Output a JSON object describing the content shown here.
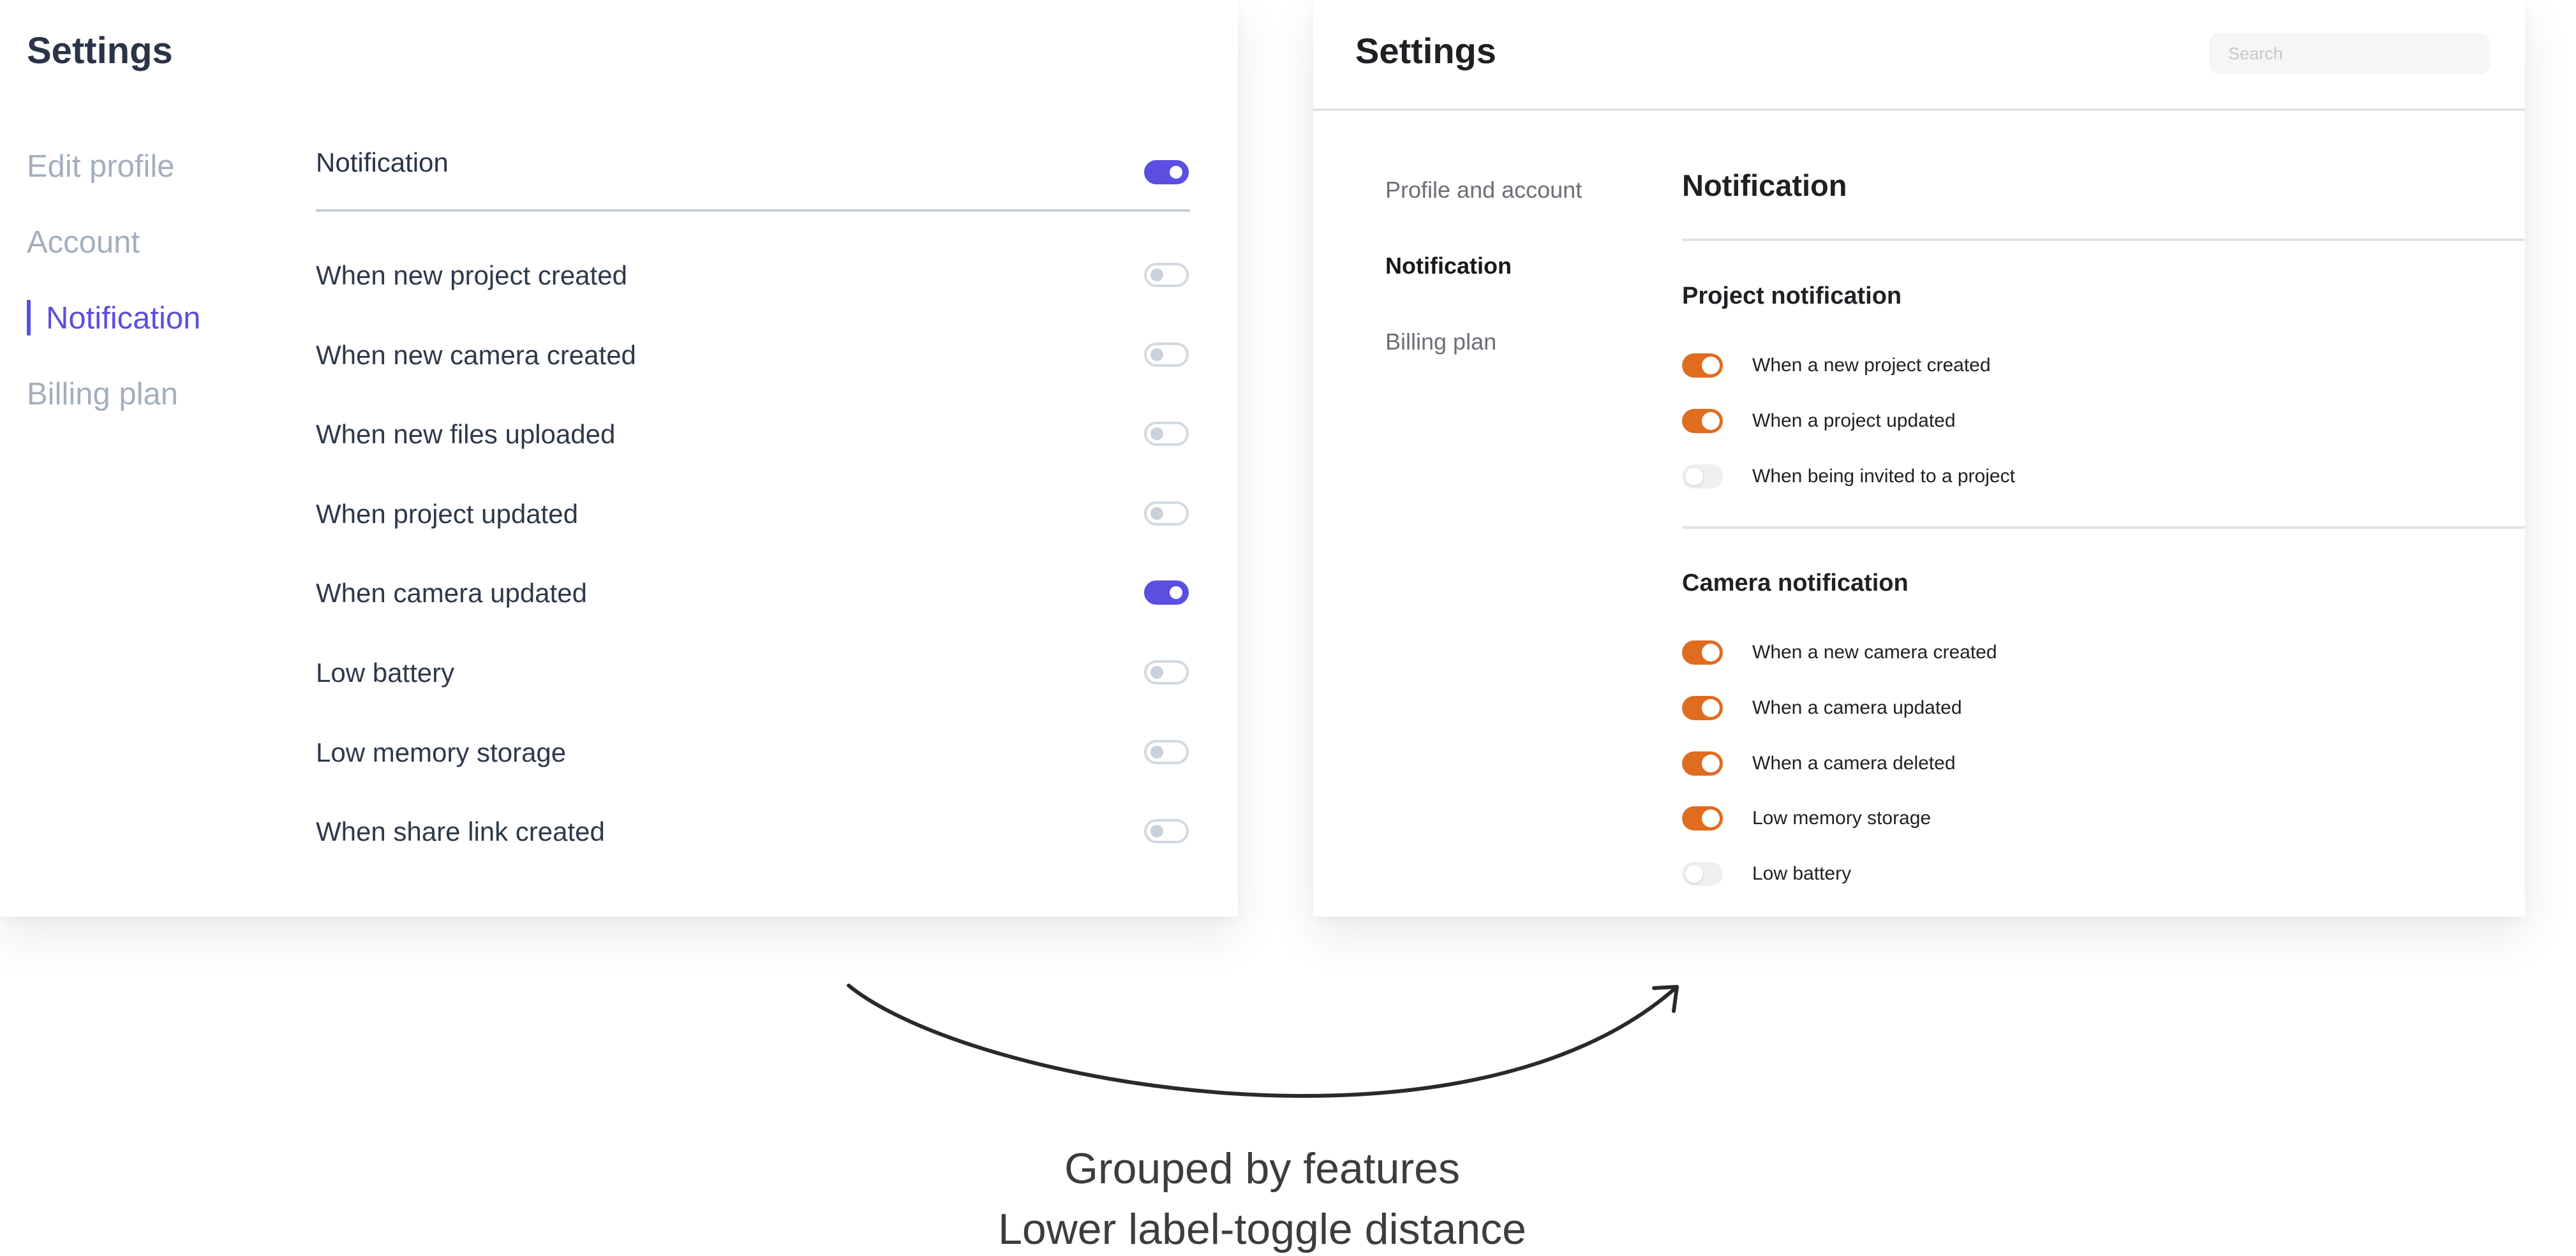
{
  "before": {
    "title": "Settings",
    "nav": [
      {
        "label": "Edit profile",
        "active": false
      },
      {
        "label": "Account",
        "active": false
      },
      {
        "label": "Notification",
        "active": true
      },
      {
        "label": "Billing plan",
        "active": false
      }
    ],
    "master": {
      "label": "Notification",
      "on": true
    },
    "rows": [
      {
        "label": "When new project created",
        "on": false
      },
      {
        "label": "When new camera created",
        "on": false
      },
      {
        "label": "When new files uploaded",
        "on": false
      },
      {
        "label": "When project updated",
        "on": false
      },
      {
        "label": "When camera updated",
        "on": true
      },
      {
        "label": "Low battery",
        "on": false
      },
      {
        "label": "Low memory storage",
        "on": false
      },
      {
        "label": "When share link created",
        "on": false
      }
    ],
    "accent_color": "#5a4fe0"
  },
  "after": {
    "title": "Settings",
    "search": {
      "placeholder": "Search",
      "value": ""
    },
    "nav": [
      {
        "label": "Profile and account",
        "active": false
      },
      {
        "label": "Notification",
        "active": true
      },
      {
        "label": "Billing plan",
        "active": false
      }
    ],
    "heading": "Notification",
    "groups": [
      {
        "title": "Project notification",
        "rows": [
          {
            "label": "When a new project created",
            "on": true
          },
          {
            "label": "When a project updated",
            "on": true
          },
          {
            "label": "When being invited to a project",
            "on": false
          }
        ]
      },
      {
        "title": "Camera notification",
        "rows": [
          {
            "label": "When a new camera created",
            "on": true
          },
          {
            "label": "When a camera updated",
            "on": true
          },
          {
            "label": "When a camera deleted",
            "on": true
          },
          {
            "label": "Low memory storage",
            "on": true
          },
          {
            "label": "Low battery",
            "on": false
          }
        ]
      }
    ],
    "accent_color": "#e06c1f"
  },
  "caption": {
    "line1": "Grouped by features",
    "line2": "Lower label-toggle distance"
  }
}
